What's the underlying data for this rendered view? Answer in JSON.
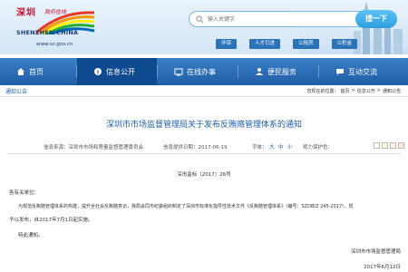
{
  "logo": {
    "title_cn": "深圳",
    "title_cn_sub": "政府在线",
    "title_en": "SHENZHEN CHINA",
    "url": "www.sz.gov.cn"
  },
  "search": {
    "placeholder": "输入关键字",
    "button_label": "搜一下"
  },
  "quick_links": [
    "环保",
    "人才引进",
    "公租房",
    "公积金"
  ],
  "nav": {
    "items": [
      {
        "label": "首页",
        "icon": "home-icon"
      },
      {
        "label": "信息公开",
        "icon": "info-icon"
      },
      {
        "label": "在线办事",
        "icon": "online-service-icon"
      },
      {
        "label": "便民服务",
        "icon": "people-service-icon"
      },
      {
        "label": "互动交流",
        "icon": "chat-icon"
      }
    ],
    "active_index": 1
  },
  "breadcrumb": {
    "section_title": "通知公告",
    "prefix": "您现在的位置：",
    "items": [
      "首页",
      "信息公开",
      "通知公告"
    ],
    "separator": ">"
  },
  "article": {
    "title": "深圳市市场监督管理局关于发布反贿赂管理体系的通知",
    "meta": {
      "source_label": "信息来源：深圳市市场和质量监督管理委员会",
      "date_label": "信息提供日期：2017-06-19",
      "font_label": "字体：",
      "font_sizes": [
        "大",
        "中",
        "小"
      ],
      "color_label": "视力保护色：",
      "colors": [
        "#ffffff",
        "#faf9de",
        "#fff2e2",
        "#fde6e0",
        "#e3edcd",
        "#dce2f1",
        "#e9ebfe"
      ]
    },
    "doc_number": "深市监标〔2017〕26号",
    "salutation": "各有关单位：",
    "paragraph_1": "为规范反贿赂管理体系的构建，提升全社会反贿赂意识，我局会同市纪委组织制定了深圳市标准化指导性技术文件《反贿赂管理体系》（编号：SZDB/Z 245-2017），现",
    "paragraph_1_cont": "予以发布，自2017年7月1日起实施。",
    "closing": "特此通知。",
    "signature": "深圳市市场监督管理局",
    "sign_date": "2017年6月12日"
  }
}
